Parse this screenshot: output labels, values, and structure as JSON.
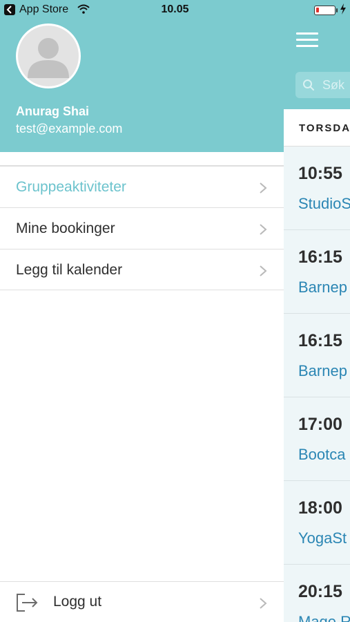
{
  "status_bar": {
    "back_app": "App Store",
    "time": "10.05",
    "battery_level": 0.15,
    "battery_color": "#e0302a"
  },
  "drawer": {
    "header_color": "#7ccbcf",
    "user": {
      "name": "Anurag Shai",
      "email": "test@example.com",
      "avatar_icon": "person-avatar-icon"
    },
    "menu": [
      {
        "label": "Gruppeaktiviteter",
        "active": true,
        "icon": "chevron-right-icon"
      },
      {
        "label": "Mine bookinger",
        "active": false,
        "icon": "chevron-right-icon"
      },
      {
        "label": "Legg til kalender",
        "active": false,
        "icon": "chevron-right-icon"
      }
    ],
    "logout": {
      "label": "Logg ut",
      "icon": "logout-icon"
    },
    "active_color": "#6cc3cd"
  },
  "background_page": {
    "menu_icon": "hamburger-icon",
    "search": {
      "placeholder": "Søk",
      "icon": "search-icon"
    },
    "day_label": "TORSDA",
    "activities": [
      {
        "time": "10:55",
        "name": "StudioS"
      },
      {
        "time": "16:15",
        "name": "Barnep"
      },
      {
        "time": "16:15",
        "name": "Barnep"
      },
      {
        "time": "17:00",
        "name": "Bootca"
      },
      {
        "time": "18:00",
        "name": "YogaSt"
      },
      {
        "time": "20:15",
        "name": "Mage R"
      }
    ],
    "link_color": "#2b86b4"
  }
}
